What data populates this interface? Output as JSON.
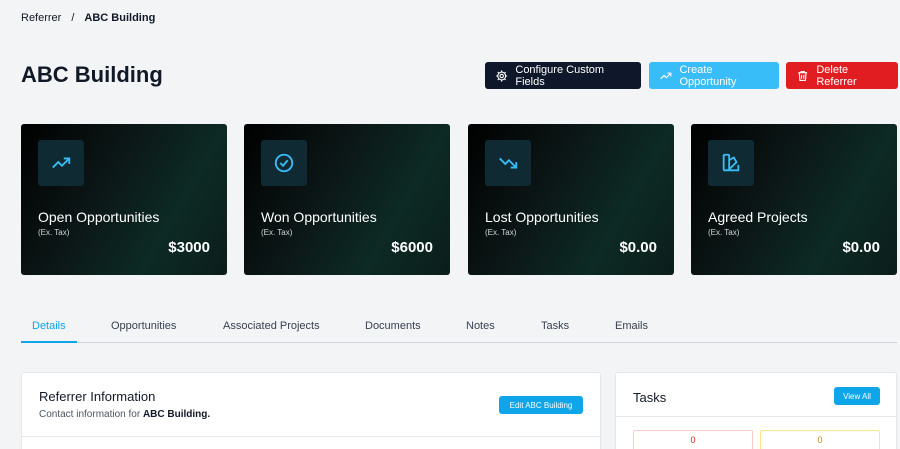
{
  "breadcrumb": {
    "parent": "Referrer",
    "separator": "/",
    "current": "ABC Building"
  },
  "page": {
    "title": "ABC Building"
  },
  "actions": {
    "configure": "Configure Custom Fields",
    "create": "Create Opportunity",
    "delete": "Delete Referrer"
  },
  "cards": [
    {
      "label": "Open Opportunities",
      "sub": "(Ex. Tax)",
      "amount": "$3000",
      "icon": "trending-up-icon"
    },
    {
      "label": "Won Opportunities",
      "sub": "(Ex. Tax)",
      "amount": "$6000",
      "icon": "check-circle-icon"
    },
    {
      "label": "Lost Opportunities",
      "sub": "(Ex. Tax)",
      "amount": "$0.00",
      "icon": "trending-down-icon"
    },
    {
      "label": "Agreed Projects",
      "sub": "(Ex. Tax)",
      "amount": "$0.00",
      "icon": "swatch-icon"
    }
  ],
  "tabs": [
    "Details",
    "Opportunities",
    "Associated Projects",
    "Documents",
    "Notes",
    "Tasks",
    "Emails"
  ],
  "referrer_info": {
    "title": "Referrer Information",
    "subtitle_prefix": "Contact information for ",
    "subtitle_name": "ABC Building.",
    "edit_label": "Edit ABC Building"
  },
  "tasks_panel": {
    "title": "Tasks",
    "view_all": "View All",
    "overdue_count": "0",
    "pending_count": "0"
  },
  "colors": {
    "primary": "#0ea5e9",
    "dark": "#0f172a",
    "danger": "#e11d22"
  }
}
